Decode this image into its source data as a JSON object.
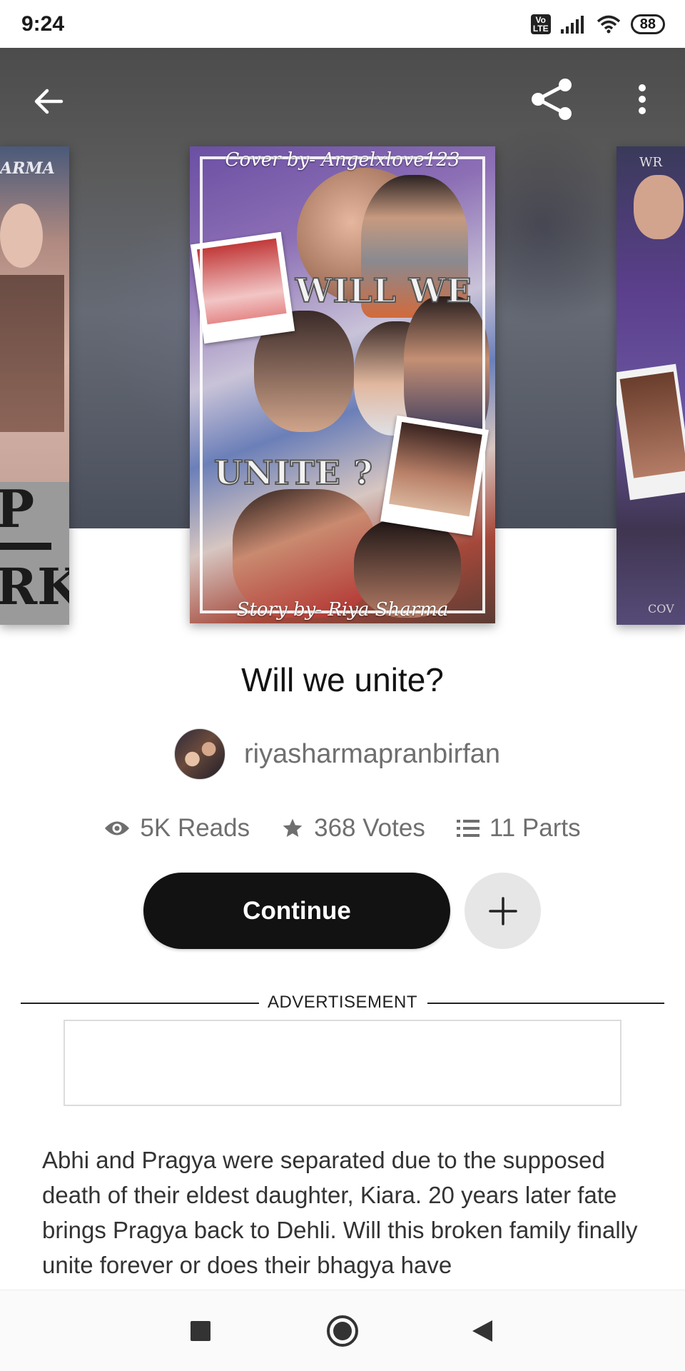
{
  "status_bar": {
    "time": "9:24",
    "volte": "Vo LTE",
    "battery": "88"
  },
  "header": {
    "back_icon": "arrow-left-icon",
    "share_icon": "share-icon",
    "more_icon": "more-vertical-icon"
  },
  "cover": {
    "credit_top": "Cover by- Angelxlove123",
    "word_1": "WILL WE",
    "word_2": "UNITE ?",
    "credit_bottom": "Story by- Riya Sharma",
    "side_left_text_top": "ARMA",
    "side_left_text_mid": "P",
    "side_left_text_bottom": "RK",
    "side_right_text_top": "WR",
    "side_right_text_bottom": "COV"
  },
  "story": {
    "title": "Will we unite?",
    "author": "riyasharmapranbirfan"
  },
  "stats": {
    "reads": "5K Reads",
    "votes": "368 Votes",
    "parts": "11 Parts"
  },
  "actions": {
    "continue_label": "Continue",
    "add_icon": "plus-icon"
  },
  "ad": {
    "label": "ADVERTISEMENT"
  },
  "description": "Abhi and Pragya were separated due to the supposed death of their eldest daughter, Kiara. 20 years later fate brings Pragya back to Dehli. Will this broken family finally unite forever or does their bhagya have",
  "nav": {
    "recents_icon": "square-icon",
    "home_icon": "circle-home-icon",
    "back_icon": "triangle-back-icon"
  }
}
